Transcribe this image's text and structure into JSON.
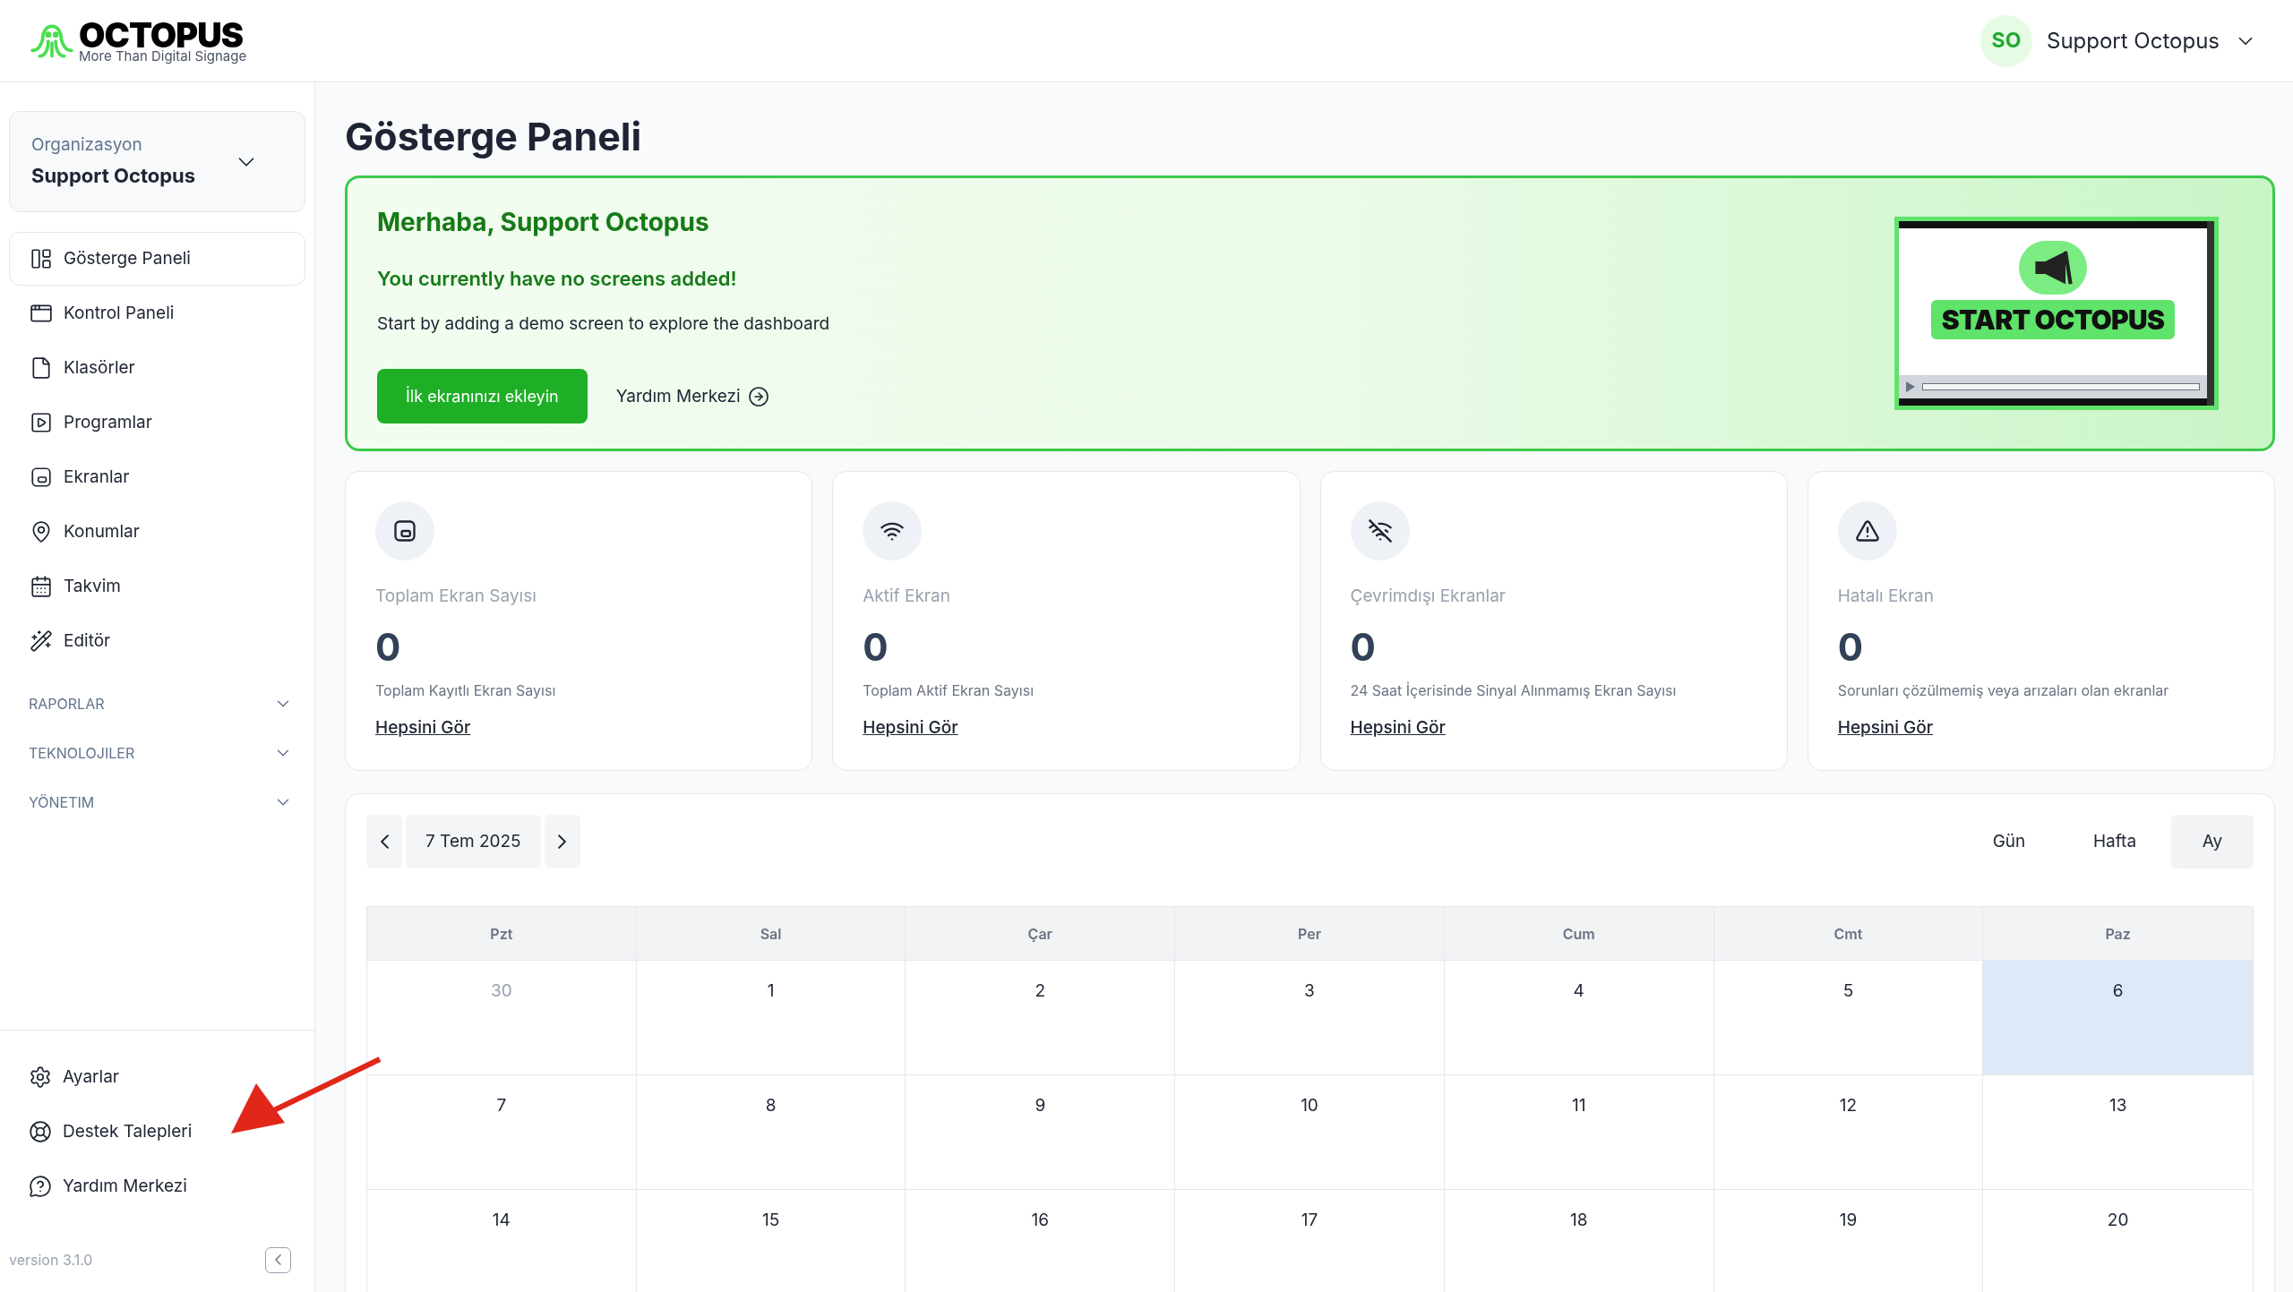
{
  "logo": {
    "name": "OCTOPUS",
    "tagline": "More Than Digital Signage"
  },
  "user": {
    "initials": "SO",
    "name": "Support Octopus"
  },
  "sidebar": {
    "organization": {
      "label": "Organizasyon",
      "value": "Support Octopus"
    },
    "items": [
      {
        "label": "Gösterge Paneli",
        "selected": true
      },
      {
        "label": "Kontrol Paneli",
        "selected": false
      },
      {
        "label": "Klasörler",
        "selected": false
      },
      {
        "label": "Programlar",
        "selected": false
      },
      {
        "label": "Ekranlar",
        "selected": false
      },
      {
        "label": "Konumlar",
        "selected": false
      },
      {
        "label": "Takvim",
        "selected": false
      },
      {
        "label": "Editör",
        "selected": false
      }
    ],
    "sections": [
      {
        "label": "RAPORLAR",
        "expanded": false
      },
      {
        "label": "TEKNOLOJILER",
        "expanded": false
      },
      {
        "label": "YÖNETIM",
        "expanded": false
      }
    ],
    "bottom_items": [
      {
        "label": "Ayarlar"
      },
      {
        "label": "Destek Talepleri"
      },
      {
        "label": "Yardım Merkezi"
      }
    ],
    "version": "version 3.1.0"
  },
  "page_title": "Gösterge Paneli",
  "banner": {
    "greeting": "Merhaba, Support Octopus",
    "warning": "You currently have no screens added!",
    "hint": "Start by adding a demo screen to explore the dashboard",
    "primary_button": "İlk ekranınızı ekleyin",
    "help_link": "Yardım Merkezi",
    "illustration_text": "START OCTOPUS"
  },
  "stats": [
    {
      "title": "Toplam Ekran Sayısı",
      "value": "0",
      "description": "Toplam Kayıtlı Ekran Sayısı",
      "link": "Hepsini Gör"
    },
    {
      "title": "Aktif Ekran",
      "value": "0",
      "description": "Toplam Aktif Ekran Sayısı",
      "link": "Hepsini Gör"
    },
    {
      "title": "Çevrimdışı Ekranlar",
      "value": "0",
      "description": "24 Saat İçerisinde Sinyal Alınmamış Ekran Sayısı",
      "link": "Hepsini Gör"
    },
    {
      "title": "Hatalı Ekran",
      "value": "0",
      "description": "Sorunları çözülmemiş veya arızaları olan ekranlar",
      "link": "Hepsini Gör"
    }
  ],
  "calendar": {
    "date": "7 Tem 2025",
    "views": [
      {
        "label": "Gün",
        "selected": false
      },
      {
        "label": "Hafta",
        "selected": false
      },
      {
        "label": "Ay",
        "selected": true
      }
    ],
    "weekdays": [
      "Pzt",
      "Sal",
      "Çar",
      "Per",
      "Cum",
      "Cmt",
      "Paz"
    ],
    "weeks": [
      [
        {
          "day": "30",
          "outside": true,
          "today": false
        },
        {
          "day": "1",
          "outside": false,
          "today": false
        },
        {
          "day": "2",
          "outside": false,
          "today": false
        },
        {
          "day": "3",
          "outside": false,
          "today": false
        },
        {
          "day": "4",
          "outside": false,
          "today": false
        },
        {
          "day": "5",
          "outside": false,
          "today": false
        },
        {
          "day": "6",
          "outside": false,
          "today": true
        }
      ],
      [
        {
          "day": "7",
          "outside": false,
          "today": false
        },
        {
          "day": "8",
          "outside": false,
          "today": false
        },
        {
          "day": "9",
          "outside": false,
          "today": false
        },
        {
          "day": "10",
          "outside": false,
          "today": false
        },
        {
          "day": "11",
          "outside": false,
          "today": false
        },
        {
          "day": "12",
          "outside": false,
          "today": false
        },
        {
          "day": "13",
          "outside": false,
          "today": false
        }
      ],
      [
        {
          "day": "14",
          "outside": false,
          "today": false
        },
        {
          "day": "15",
          "outside": false,
          "today": false
        },
        {
          "day": "16",
          "outside": false,
          "today": false
        },
        {
          "day": "17",
          "outside": false,
          "today": false
        },
        {
          "day": "18",
          "outside": false,
          "today": false
        },
        {
          "day": "19",
          "outside": false,
          "today": false
        },
        {
          "day": "20",
          "outside": false,
          "today": false
        }
      ]
    ]
  }
}
